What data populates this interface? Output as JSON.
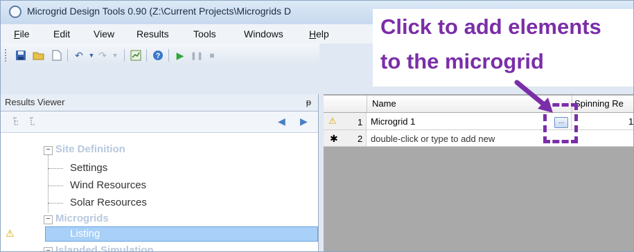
{
  "window": {
    "title": "Microgrid Design Tools 0.90 (Z:\\Current Projects\\Microgrids D"
  },
  "menu": [
    {
      "label": "File",
      "underline": "F",
      "rest": "ile"
    },
    {
      "label": "Edit"
    },
    {
      "label": "View"
    },
    {
      "label": "Results"
    },
    {
      "label": "Tools"
    },
    {
      "label": "Windows"
    },
    {
      "label": "Help",
      "underline": "H",
      "rest": "elp"
    }
  ],
  "panel": {
    "title": "Results Viewer",
    "pin": "ᵽ",
    "nav_prev": "◀",
    "nav_next": "▶"
  },
  "tree": {
    "groups": [
      {
        "label": "Site Definition",
        "expander": "⊟",
        "items": [
          "Settings",
          "Wind Resources",
          "Solar Resources"
        ]
      },
      {
        "label": "Microgrids",
        "expander": "⊟",
        "items": [
          "Listing"
        ]
      },
      {
        "label": "Islanded Simulation",
        "expander": "⊟"
      }
    ]
  },
  "grid": {
    "columns": [
      "Name",
      "Spinning Re"
    ],
    "rows": [
      {
        "num": "1",
        "name": "Microgrid 1",
        "spinning": "1",
        "status": "warning"
      },
      {
        "num": "2",
        "name": "double-click or type to add new",
        "status": "new"
      }
    ],
    "ellipsis": "..."
  },
  "annotation": {
    "line1": "Click to add elements",
    "line2": "to the microgrid",
    "color": "#7b2ea8"
  },
  "icons": {
    "warning": "⚠",
    "new_row": "✱"
  }
}
